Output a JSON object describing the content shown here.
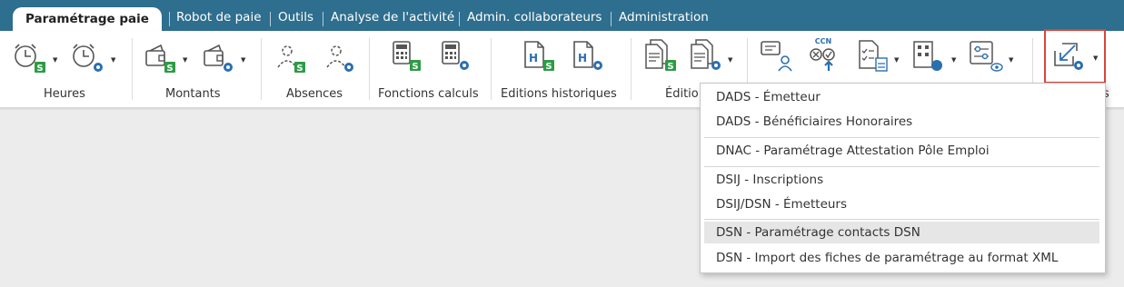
{
  "tabs": [
    {
      "label": "Paramétrage paie",
      "active": true
    },
    {
      "label": "Robot de paie"
    },
    {
      "label": "Outils"
    },
    {
      "label": "Analyse de l'activité"
    },
    {
      "label": "Admin. collaborateurs"
    },
    {
      "label": "Administration"
    }
  ],
  "ribbon": {
    "groups": [
      {
        "label": "Heures"
      },
      {
        "label": "Montants"
      },
      {
        "label": "Absences"
      },
      {
        "label": "Fonctions calculs"
      },
      {
        "label": "Editions historiques"
      },
      {
        "label": "Éditio"
      },
      {
        "label": "s"
      }
    ],
    "icons": {
      "badge_s": "S",
      "badge_h": "H",
      "ccn": "CCN"
    }
  },
  "menu": {
    "items": [
      {
        "label": "DADS - Émetteur"
      },
      {
        "label": "DADS - Bénéficiaires Honoraires"
      },
      {
        "label": "DNAC - Paramétrage Attestation Pôle Emploi"
      },
      {
        "label": "DSIJ - Inscriptions"
      },
      {
        "label": "DSIJ/DSN - Émetteurs"
      },
      {
        "label": "DSN - Paramétrage contacts DSN",
        "hovered": true
      },
      {
        "label": "DSN - Import des fiches de paramétrage au format XML"
      }
    ]
  },
  "colors": {
    "tabbar": "#2e6e8e",
    "badge_green": "#2e9b45",
    "gear_blue": "#2a6fb0",
    "highlight_red": "#d9453a"
  }
}
